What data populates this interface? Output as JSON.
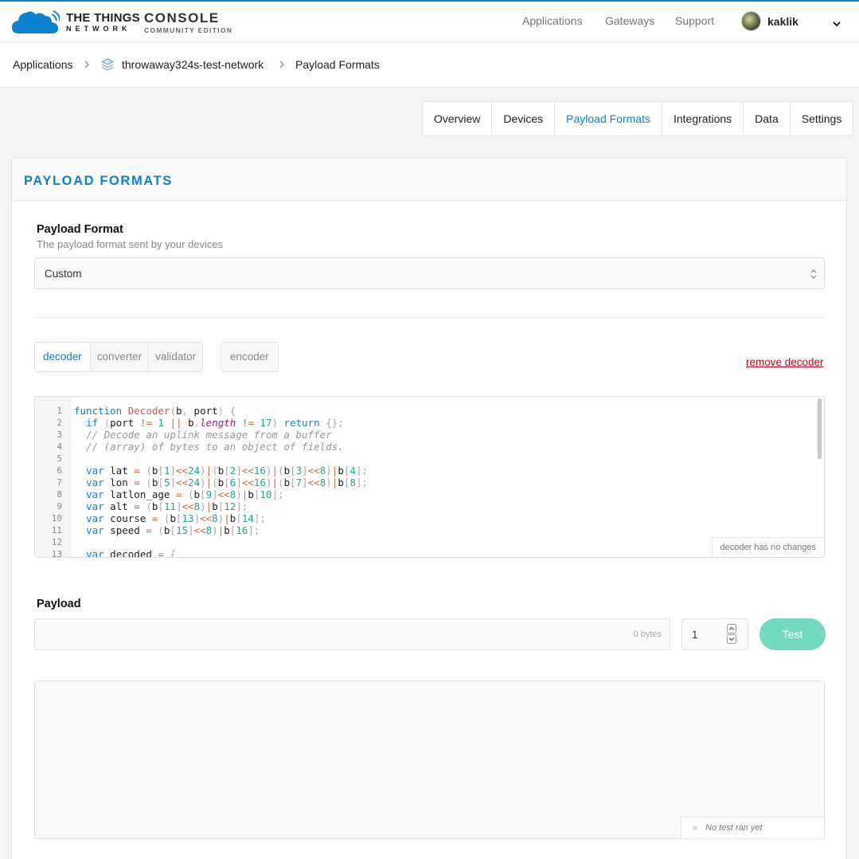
{
  "brand": {
    "line1": "THE THINGS",
    "line2": "NETWORK",
    "console": "CONSOLE",
    "edition": "COMMUNITY EDITION",
    "accent_color": "#0d83d0"
  },
  "topnav": {
    "items": [
      "Applications",
      "Gateways",
      "Support"
    ],
    "user": "kaklik"
  },
  "breadcrumb": [
    "Applications",
    "throwaway324s-test-network",
    "Payload Formats"
  ],
  "tabs": [
    {
      "label": "Overview",
      "active": false
    },
    {
      "label": "Devices",
      "active": false
    },
    {
      "label": "Payload Formats",
      "active": true
    },
    {
      "label": "Integrations",
      "active": false
    },
    {
      "label": "Data",
      "active": false
    },
    {
      "label": "Settings",
      "active": false
    }
  ],
  "panel": {
    "title": "PAYLOAD FORMATS",
    "format_label": "Payload Format",
    "format_desc": "The payload format sent by your devices",
    "format_value": "Custom",
    "functions": [
      "decoder",
      "converter",
      "validator"
    ],
    "encoder": "encoder",
    "remove_link": "remove decoder",
    "editor_status": "decoder has no changes",
    "payload_label": "Payload",
    "payload_value": "",
    "bytes": "0 bytes",
    "port": "1",
    "test_button": "Test",
    "result_status": "No test ran yet"
  },
  "code_lines": [
    "function Decoder(b, port) {",
    "  if (port != 1 || b.length != 17) return {};",
    "  // Decode an uplink message from a buffer",
    "  // (array) of bytes to an object of fields.",
    "",
    "  var lat = (b[1]<<24)|(b[2]<<16)|(b[3]<<8)|b[4];",
    "  var lon = (b[5]<<24)|(b[6]<<16)|(b[7]<<8)|b[8];",
    "  var latlon_age = (b[9]<<8)|b[10];",
    "  var alt = (b[11]<<8)|b[12];",
    "  var course = (b[13]<<8)|b[14];",
    "  var speed = (b[15]<<8)|b[16];",
    "",
    "  var decoded = {"
  ]
}
